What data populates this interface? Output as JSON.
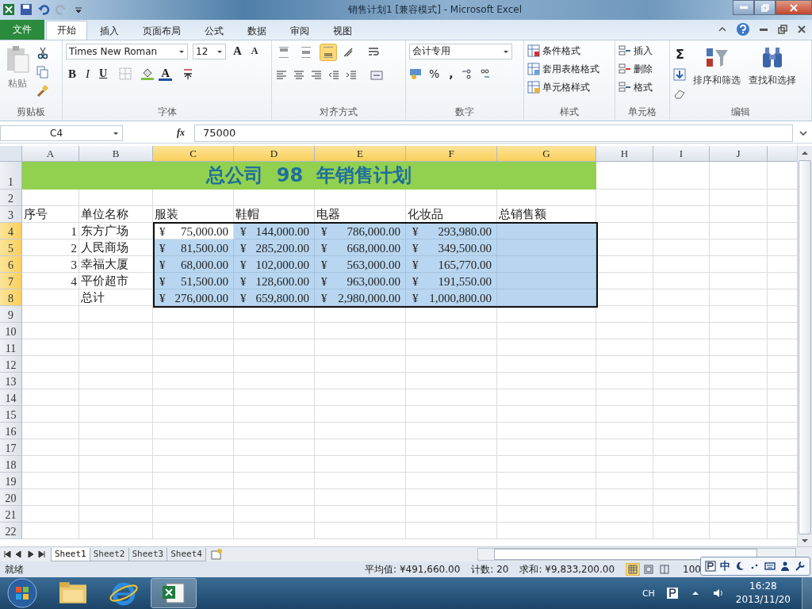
{
  "window": {
    "title": "销售计划1  [兼容模式]  -  Microsoft Excel"
  },
  "tabs": [
    {
      "label": "文件",
      "kind": "file",
      "selected": false
    },
    {
      "label": "开始",
      "kind": "tab",
      "selected": true
    },
    {
      "label": "插入",
      "kind": "tab",
      "selected": false
    },
    {
      "label": "页面布局",
      "kind": "tab",
      "selected": false
    },
    {
      "label": "公式",
      "kind": "tab",
      "selected": false
    },
    {
      "label": "数据",
      "kind": "tab",
      "selected": false
    },
    {
      "label": "审阅",
      "kind": "tab",
      "selected": false
    },
    {
      "label": "视图",
      "kind": "tab",
      "selected": false
    }
  ],
  "ribbon": {
    "clipboard": {
      "paste": "粘贴",
      "label": "剪贴板"
    },
    "font": {
      "name": "Times New Roman",
      "size": "12",
      "grow": "A",
      "shrink": "A",
      "bold": "B",
      "italic": "I",
      "underline": "U",
      "font_color": "A",
      "label": "字体"
    },
    "alignment": {
      "vertical": [
        {
          "selected": false
        },
        {
          "selected": false
        },
        {
          "selected": true
        }
      ],
      "label": "对齐方式"
    },
    "number": {
      "format": "会计专用",
      "percent": "%",
      "comma": ",",
      "label": "数字"
    },
    "styles": {
      "items": [
        "条件格式",
        "套用表格格式",
        "单元格样式"
      ],
      "label": "样式"
    },
    "cells": {
      "items": [
        "插入",
        "删除",
        "格式"
      ],
      "label": "单元格"
    },
    "editing": {
      "sigma": "Σ",
      "items": [
        "排序和筛选",
        "查找和选择"
      ],
      "label": "编辑"
    }
  },
  "formula_bar": {
    "name_box": "C4",
    "fx": "fx",
    "value": "75000"
  },
  "columns": [
    {
      "label": "A",
      "selected": false
    },
    {
      "label": "B",
      "selected": false
    },
    {
      "label": "C",
      "selected": true
    },
    {
      "label": "D",
      "selected": true
    },
    {
      "label": "E",
      "selected": true
    },
    {
      "label": "F",
      "selected": true
    },
    {
      "label": "G",
      "selected": true
    },
    {
      "label": "H",
      "selected": false
    },
    {
      "label": "I",
      "selected": false
    },
    {
      "label": "J",
      "selected": false
    }
  ],
  "rows": [
    {
      "num": "1",
      "kind": "title",
      "selected": false,
      "text": "总公司  98  年销售计划"
    },
    {
      "num": "2",
      "kind": "empty",
      "selected": false
    },
    {
      "num": "3",
      "kind": "header",
      "selected": false,
      "cells": [
        "序号",
        "单位名称",
        "服装",
        "鞋帽",
        "电器",
        "化妆品",
        "总销售额"
      ]
    },
    {
      "num": "4",
      "kind": "data",
      "selected": true,
      "seq": "1",
      "name": "东方广场",
      "amounts": [
        {
          "symbol": "¥",
          "amount": "75,000.00",
          "active": true
        },
        {
          "symbol": "¥",
          "amount": "144,000.00",
          "active": false
        },
        {
          "symbol": "¥",
          "amount": "786,000.00",
          "active": false
        },
        {
          "symbol": "¥",
          "amount": "293,980.00",
          "active": false
        }
      ]
    },
    {
      "num": "5",
      "kind": "data",
      "selected": true,
      "seq": "2",
      "name": "人民商场",
      "amounts": [
        {
          "symbol": "¥",
          "amount": "81,500.00",
          "active": false
        },
        {
          "symbol": "¥",
          "amount": "285,200.00",
          "active": false
        },
        {
          "symbol": "¥",
          "amount": "668,000.00",
          "active": false
        },
        {
          "symbol": "¥",
          "amount": "349,500.00",
          "active": false
        }
      ]
    },
    {
      "num": "6",
      "kind": "data",
      "selected": true,
      "seq": "3",
      "name": "幸福大厦",
      "amounts": [
        {
          "symbol": "¥",
          "amount": "68,000.00",
          "active": false
        },
        {
          "symbol": "¥",
          "amount": "102,000.00",
          "active": false
        },
        {
          "symbol": "¥",
          "amount": "563,000.00",
          "active": false
        },
        {
          "symbol": "¥",
          "amount": "165,770.00",
          "active": false
        }
      ]
    },
    {
      "num": "7",
      "kind": "data",
      "selected": true,
      "seq": "4",
      "name": "平价超市",
      "amounts": [
        {
          "symbol": "¥",
          "amount": "51,500.00",
          "active": false
        },
        {
          "symbol": "¥",
          "amount": "128,600.00",
          "active": false
        },
        {
          "symbol": "¥",
          "amount": "963,000.00",
          "active": false
        },
        {
          "symbol": "¥",
          "amount": "191,550.00",
          "active": false
        }
      ]
    },
    {
      "num": "8",
      "kind": "data",
      "selected": true,
      "name": "总计",
      "amounts": [
        {
          "symbol": "¥",
          "amount": "276,000.00",
          "active": false
        },
        {
          "symbol": "¥",
          "amount": "659,800.00",
          "active": false
        },
        {
          "symbol": "¥",
          "amount": "2,980,000.00",
          "active": false
        },
        {
          "symbol": "¥",
          "amount": "1,000,800.00",
          "active": false
        }
      ]
    },
    {
      "num": "9",
      "kind": "empty",
      "selected": false
    },
    {
      "num": "10",
      "kind": "empty",
      "selected": false
    },
    {
      "num": "11",
      "kind": "empty",
      "selected": false
    },
    {
      "num": "12",
      "kind": "empty",
      "selected": false
    },
    {
      "num": "13",
      "kind": "empty",
      "selected": false
    },
    {
      "num": "14",
      "kind": "empty",
      "selected": false
    },
    {
      "num": "15",
      "kind": "empty",
      "selected": false
    },
    {
      "num": "16",
      "kind": "empty",
      "selected": false
    },
    {
      "num": "17",
      "kind": "empty",
      "selected": false
    },
    {
      "num": "18",
      "kind": "empty",
      "selected": false
    },
    {
      "num": "19",
      "kind": "empty",
      "selected": false
    },
    {
      "num": "20",
      "kind": "empty",
      "selected": false
    },
    {
      "num": "21",
      "kind": "empty",
      "selected": false
    },
    {
      "num": "22",
      "kind": "empty",
      "selected": false
    }
  ],
  "sheets": [
    {
      "label": "Sheet1",
      "selected": true
    },
    {
      "label": "Sheet2",
      "selected": false
    },
    {
      "label": "Sheet3",
      "selected": false
    },
    {
      "label": "Sheet4",
      "selected": false
    }
  ],
  "status_bar": {
    "ready": "就绪",
    "stats": [
      "平均值: ¥491,660.00",
      "计数: 20",
      "求和: ¥9,833,200.00"
    ],
    "views": [
      {
        "selected": true
      },
      {
        "selected": false
      },
      {
        "selected": false
      }
    ],
    "zoom": "100",
    "ime": "中"
  },
  "taskbar": {
    "lang": "CH",
    "time": "16:28",
    "date": "2013/11/20"
  }
}
